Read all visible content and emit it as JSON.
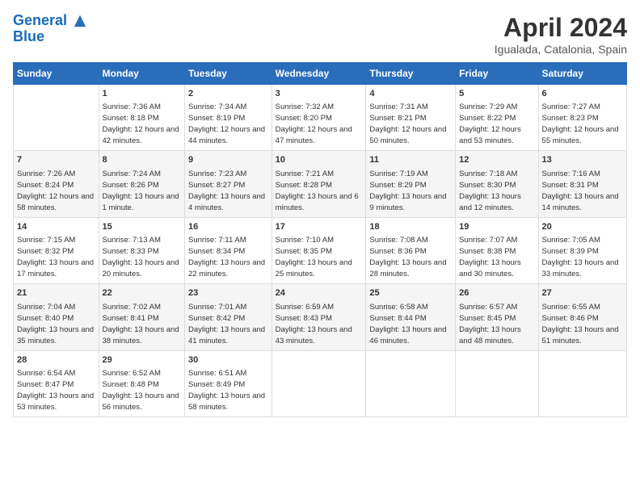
{
  "logo": {
    "line1": "General",
    "line2": "Blue"
  },
  "title": "April 2024",
  "subtitle": "Igualada, Catalonia, Spain",
  "days_header": [
    "Sunday",
    "Monday",
    "Tuesday",
    "Wednesday",
    "Thursday",
    "Friday",
    "Saturday"
  ],
  "weeks": [
    [
      {
        "day": "",
        "sunrise": "",
        "sunset": "",
        "daylight": ""
      },
      {
        "day": "1",
        "sunrise": "Sunrise: 7:36 AM",
        "sunset": "Sunset: 8:18 PM",
        "daylight": "Daylight: 12 hours and 42 minutes."
      },
      {
        "day": "2",
        "sunrise": "Sunrise: 7:34 AM",
        "sunset": "Sunset: 8:19 PM",
        "daylight": "Daylight: 12 hours and 44 minutes."
      },
      {
        "day": "3",
        "sunrise": "Sunrise: 7:32 AM",
        "sunset": "Sunset: 8:20 PM",
        "daylight": "Daylight: 12 hours and 47 minutes."
      },
      {
        "day": "4",
        "sunrise": "Sunrise: 7:31 AM",
        "sunset": "Sunset: 8:21 PM",
        "daylight": "Daylight: 12 hours and 50 minutes."
      },
      {
        "day": "5",
        "sunrise": "Sunrise: 7:29 AM",
        "sunset": "Sunset: 8:22 PM",
        "daylight": "Daylight: 12 hours and 53 minutes."
      },
      {
        "day": "6",
        "sunrise": "Sunrise: 7:27 AM",
        "sunset": "Sunset: 8:23 PM",
        "daylight": "Daylight: 12 hours and 55 minutes."
      }
    ],
    [
      {
        "day": "7",
        "sunrise": "Sunrise: 7:26 AM",
        "sunset": "Sunset: 8:24 PM",
        "daylight": "Daylight: 12 hours and 58 minutes."
      },
      {
        "day": "8",
        "sunrise": "Sunrise: 7:24 AM",
        "sunset": "Sunset: 8:26 PM",
        "daylight": "Daylight: 13 hours and 1 minute."
      },
      {
        "day": "9",
        "sunrise": "Sunrise: 7:23 AM",
        "sunset": "Sunset: 8:27 PM",
        "daylight": "Daylight: 13 hours and 4 minutes."
      },
      {
        "day": "10",
        "sunrise": "Sunrise: 7:21 AM",
        "sunset": "Sunset: 8:28 PM",
        "daylight": "Daylight: 13 hours and 6 minutes."
      },
      {
        "day": "11",
        "sunrise": "Sunrise: 7:19 AM",
        "sunset": "Sunset: 8:29 PM",
        "daylight": "Daylight: 13 hours and 9 minutes."
      },
      {
        "day": "12",
        "sunrise": "Sunrise: 7:18 AM",
        "sunset": "Sunset: 8:30 PM",
        "daylight": "Daylight: 13 hours and 12 minutes."
      },
      {
        "day": "13",
        "sunrise": "Sunrise: 7:16 AM",
        "sunset": "Sunset: 8:31 PM",
        "daylight": "Daylight: 13 hours and 14 minutes."
      }
    ],
    [
      {
        "day": "14",
        "sunrise": "Sunrise: 7:15 AM",
        "sunset": "Sunset: 8:32 PM",
        "daylight": "Daylight: 13 hours and 17 minutes."
      },
      {
        "day": "15",
        "sunrise": "Sunrise: 7:13 AM",
        "sunset": "Sunset: 8:33 PM",
        "daylight": "Daylight: 13 hours and 20 minutes."
      },
      {
        "day": "16",
        "sunrise": "Sunrise: 7:11 AM",
        "sunset": "Sunset: 8:34 PM",
        "daylight": "Daylight: 13 hours and 22 minutes."
      },
      {
        "day": "17",
        "sunrise": "Sunrise: 7:10 AM",
        "sunset": "Sunset: 8:35 PM",
        "daylight": "Daylight: 13 hours and 25 minutes."
      },
      {
        "day": "18",
        "sunrise": "Sunrise: 7:08 AM",
        "sunset": "Sunset: 8:36 PM",
        "daylight": "Daylight: 13 hours and 28 minutes."
      },
      {
        "day": "19",
        "sunrise": "Sunrise: 7:07 AM",
        "sunset": "Sunset: 8:38 PM",
        "daylight": "Daylight: 13 hours and 30 minutes."
      },
      {
        "day": "20",
        "sunrise": "Sunrise: 7:05 AM",
        "sunset": "Sunset: 8:39 PM",
        "daylight": "Daylight: 13 hours and 33 minutes."
      }
    ],
    [
      {
        "day": "21",
        "sunrise": "Sunrise: 7:04 AM",
        "sunset": "Sunset: 8:40 PM",
        "daylight": "Daylight: 13 hours and 35 minutes."
      },
      {
        "day": "22",
        "sunrise": "Sunrise: 7:02 AM",
        "sunset": "Sunset: 8:41 PM",
        "daylight": "Daylight: 13 hours and 38 minutes."
      },
      {
        "day": "23",
        "sunrise": "Sunrise: 7:01 AM",
        "sunset": "Sunset: 8:42 PM",
        "daylight": "Daylight: 13 hours and 41 minutes."
      },
      {
        "day": "24",
        "sunrise": "Sunrise: 6:59 AM",
        "sunset": "Sunset: 8:43 PM",
        "daylight": "Daylight: 13 hours and 43 minutes."
      },
      {
        "day": "25",
        "sunrise": "Sunrise: 6:58 AM",
        "sunset": "Sunset: 8:44 PM",
        "daylight": "Daylight: 13 hours and 46 minutes."
      },
      {
        "day": "26",
        "sunrise": "Sunrise: 6:57 AM",
        "sunset": "Sunset: 8:45 PM",
        "daylight": "Daylight: 13 hours and 48 minutes."
      },
      {
        "day": "27",
        "sunrise": "Sunrise: 6:55 AM",
        "sunset": "Sunset: 8:46 PM",
        "daylight": "Daylight: 13 hours and 51 minutes."
      }
    ],
    [
      {
        "day": "28",
        "sunrise": "Sunrise: 6:54 AM",
        "sunset": "Sunset: 8:47 PM",
        "daylight": "Daylight: 13 hours and 53 minutes."
      },
      {
        "day": "29",
        "sunrise": "Sunrise: 6:52 AM",
        "sunset": "Sunset: 8:48 PM",
        "daylight": "Daylight: 13 hours and 56 minutes."
      },
      {
        "day": "30",
        "sunrise": "Sunrise: 6:51 AM",
        "sunset": "Sunset: 8:49 PM",
        "daylight": "Daylight: 13 hours and 58 minutes."
      },
      {
        "day": "",
        "sunrise": "",
        "sunset": "",
        "daylight": ""
      },
      {
        "day": "",
        "sunrise": "",
        "sunset": "",
        "daylight": ""
      },
      {
        "day": "",
        "sunrise": "",
        "sunset": "",
        "daylight": ""
      },
      {
        "day": "",
        "sunrise": "",
        "sunset": "",
        "daylight": ""
      }
    ]
  ]
}
